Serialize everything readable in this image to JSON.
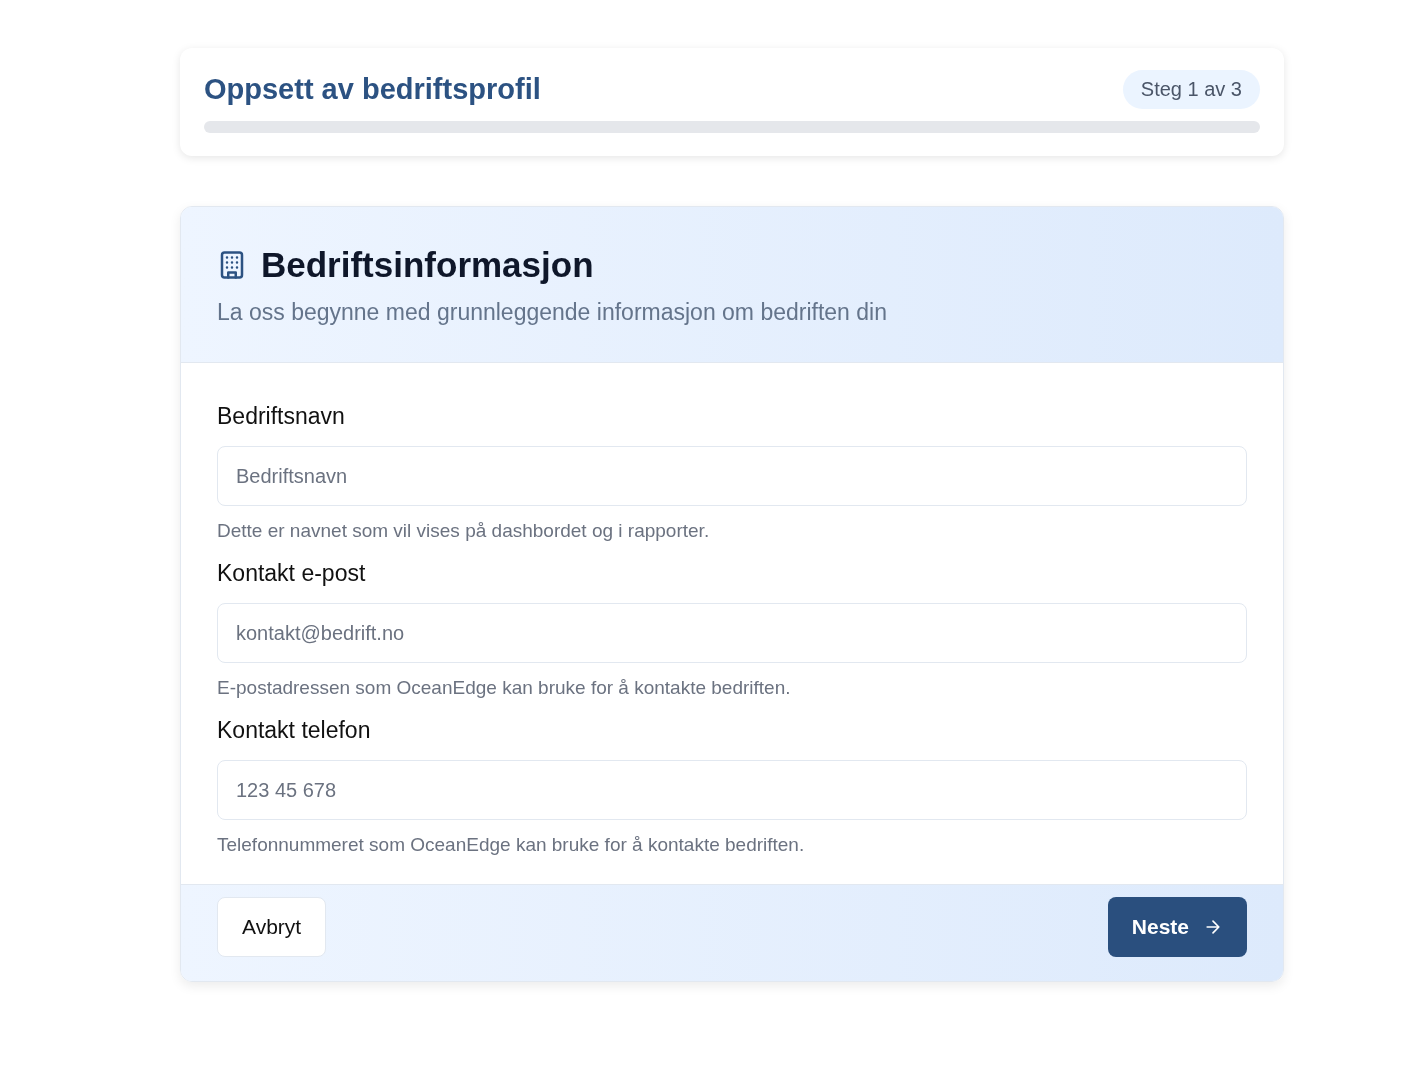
{
  "header": {
    "title": "Oppsett av bedriftsprofil",
    "step": "Steg 1 av 3",
    "progress": {
      "level": 0
    }
  },
  "card": {
    "title": "Bedriftsinformasjon",
    "subtitle": "La oss begynne med grunnleggende informasjon om bedriften din",
    "fields": [
      {
        "label": "Bedriftsnavn",
        "placeholder": "Bedriftsnavn",
        "help": "Dette er navnet som vil vises på dashbordet og i rapporter."
      },
      {
        "label": "Kontakt e-post",
        "placeholder": "kontakt@bedrift.no",
        "help": "E-postadressen som OceanEdge kan bruke for å kontakte bedriften."
      },
      {
        "label": "Kontakt telefon",
        "placeholder": "123 45 678",
        "help": "Telefonnummeret som OceanEdge kan bruke for å kontakte bedriften."
      }
    ],
    "cancel": "Avbryt",
    "next": "Neste"
  }
}
